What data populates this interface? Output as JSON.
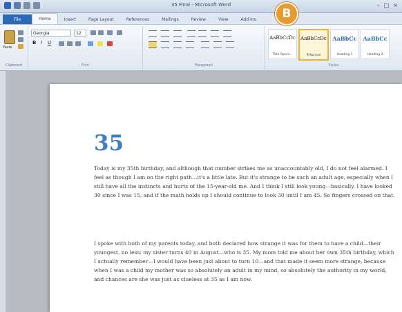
{
  "window": {
    "title": "35 Final - Microsoft Word",
    "controls": [
      "–",
      "□",
      "×"
    ]
  },
  "ribbon_tabs": [
    {
      "label": "File"
    },
    {
      "label": "Home"
    },
    {
      "label": "Insert"
    },
    {
      "label": "Page Layout"
    },
    {
      "label": "References"
    },
    {
      "label": "Mailings"
    },
    {
      "label": "Review"
    },
    {
      "label": "View"
    },
    {
      "label": "Add-Ins"
    }
  ],
  "ribbon": {
    "clipboard": {
      "paste_label": "Paste",
      "group_label": "Clipboard"
    },
    "font": {
      "font_name": "Georgia",
      "font_size": "12",
      "group_label": "Font"
    },
    "paragraph": {
      "group_label": "Paragraph"
    },
    "styles": {
      "group_label": "Styles",
      "items": [
        {
          "sample": "AaBbCcDc",
          "name": "Title Openi..."
        },
        {
          "sample": "AaBbCcDc",
          "name": "¶ Normal"
        },
        {
          "sample": "AaBbCc",
          "name": "Heading 1"
        },
        {
          "sample": "AaBbCc",
          "name": "Heading 2"
        }
      ]
    }
  },
  "callout": {
    "label": "B",
    "color": "#e99a2c"
  },
  "document": {
    "chapter_number": "35",
    "heading_color": "#3d7fc0",
    "paragraphs": [
      "Today is my 35th birthday, and although that number strikes me as unaccountably old, I do not feel alarmed. I feel as though I am on the right path…it's a little late. But it's strange to be such an adult age, especially when I still have all the instincts and hurts of the 15-year-old me. And I think I still look young—basically, I have looked 30 since I was 15, and if the math holds up I should continue to look 30 until I am 45. So fingers crossed on that.",
      "I spoke with both of my parents today, and both declared how strange it was for them to have a child—their youngest, no less: my sister turns 40 in August—who is 35. My mom told me about her own 35th birthday, which I actually remember—I would have been just about to turn 10—and that made it seem more strange, because when I was a child my mother was so absolutely an adult in my mind, so absolutely the authority in my world, and chances are she was just as clueless at 35 as I am now."
    ]
  }
}
